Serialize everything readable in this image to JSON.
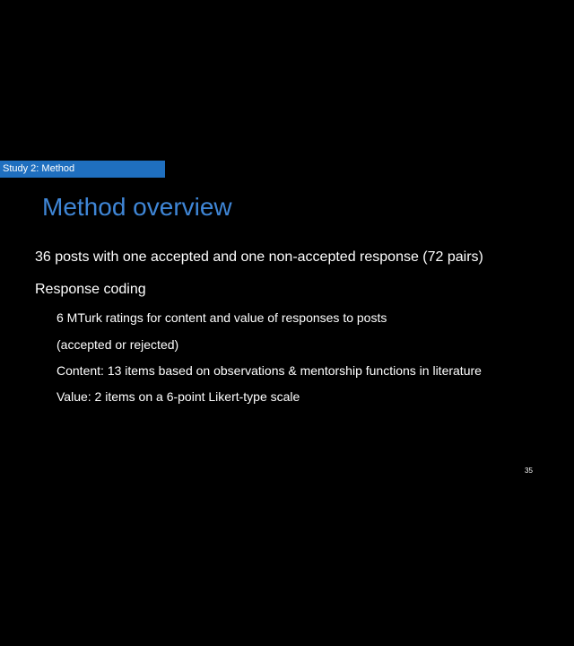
{
  "slide": {
    "section_tag": "Study 2: Method",
    "title": "Method overview",
    "bullets": [
      "36 posts with one accepted and one non-accepted response (72 pairs)",
      "Response coding",
      "6 MTurk ratings for content and value of responses to posts",
      "(accepted or rejected)",
      "Content: 13 items based on observations & mentorship functions in literature",
      "Value: 2 items on a 6-point Likert-type scale"
    ],
    "page_number": "35"
  },
  "colors": {
    "background": "#000000",
    "section_tag_background": "#1f6fbf",
    "title": "#3f86d6",
    "text": "#ffffff"
  }
}
